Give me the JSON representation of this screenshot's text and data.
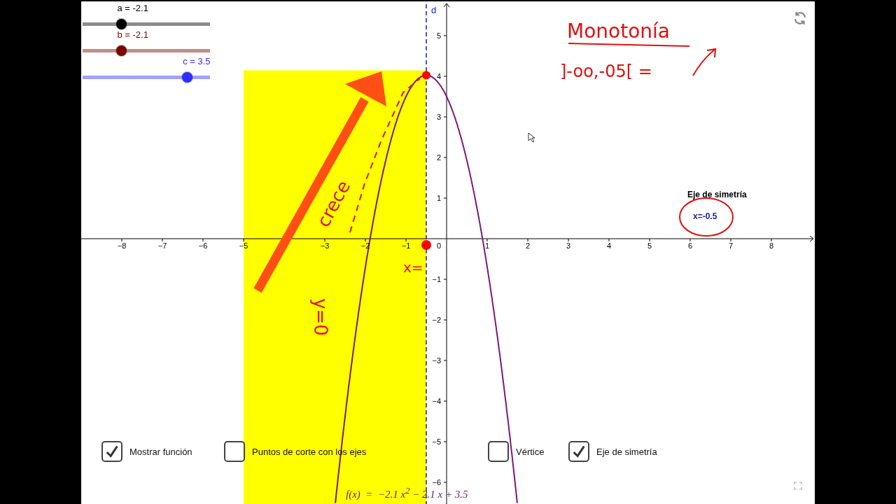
{
  "sliders": [
    {
      "label": "a = -2.1",
      "level": 0.29,
      "color": "#000000"
    },
    {
      "label": "b = -2.1",
      "level": 0.29,
      "color": "#7a0000"
    },
    {
      "label": "c = 3.5",
      "level": 0.85,
      "color": "#2d2dff"
    }
  ],
  "graph": {
    "line_label": "d",
    "origin_label": "0",
    "xticks": [
      "−8",
      "−7",
      "−6",
      "−5",
      "−3",
      "−2",
      "−1",
      "1",
      "2",
      "3",
      "4",
      "5",
      "6",
      "7",
      "8"
    ],
    "yticks": [
      "5",
      "4",
      "3",
      "2",
      "1",
      "−1",
      "−2",
      "−3",
      "−4",
      "−5",
      "−6"
    ],
    "formula": "f(x)  =  −2.1 x$^{2}$ − 2.1 x + 3.5",
    "note": {
      "title": "Eje de simetría",
      "value": "x=-0.5"
    }
  },
  "annotations": [
    "Monotonía",
    "]-oo,-05[ =",
    "crece",
    "x=",
    "y=0"
  ],
  "checkboxes": [
    {
      "label": "Mostrar función",
      "checked": true
    },
    {
      "label": "Puntos de corte con los ejes",
      "checked": false
    },
    {
      "label": "Vértice",
      "checked": false
    },
    {
      "label": "Eje de simetría",
      "checked": true
    }
  ]
}
